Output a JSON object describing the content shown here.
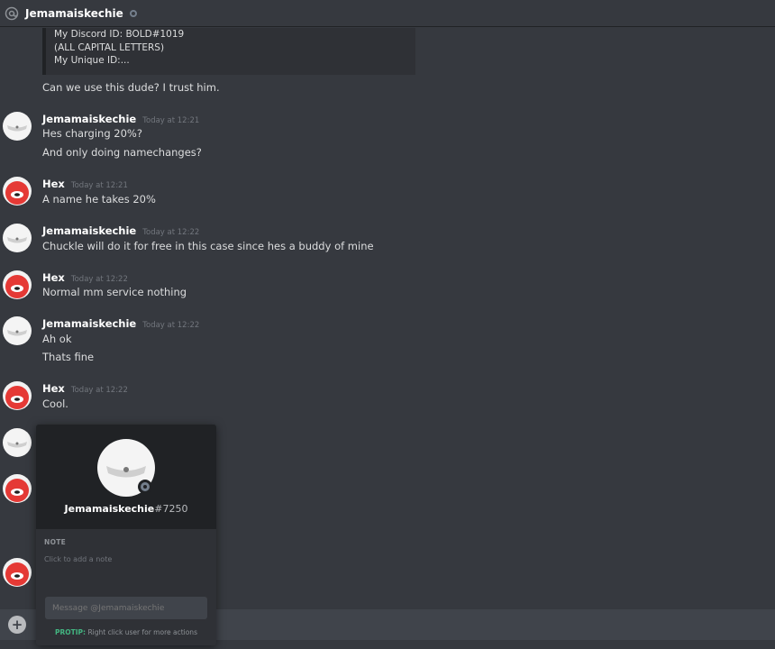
{
  "header": {
    "name": "Jemamaiskechie"
  },
  "embed": {
    "lines": [
      "My Discord ID: BOLD#1019",
      "(ALL CAPITAL LETTERS)",
      "My Unique ID:..."
    ]
  },
  "messages": [
    {
      "text": "Can we use this dude? I trust him."
    },
    {
      "author": "Jemamaiskechie",
      "time": "Today at 12:21",
      "lines": [
        "Hes charging 20%?",
        "And only doing namechanges?"
      ]
    },
    {
      "author": "Hex",
      "time": "Today at 12:21",
      "lines": [
        "A name he takes 20%"
      ]
    },
    {
      "author": "Jemamaiskechie",
      "time": "Today at 12:22",
      "lines": [
        "Chuckle will do it for free in this case since hes a buddy of mine"
      ]
    },
    {
      "author": "Hex",
      "time": "Today at 12:22",
      "lines": [
        "Normal mm service nothing"
      ]
    },
    {
      "author": "Jemamaiskechie",
      "time": "Today at 12:22",
      "lines": [
        "Ah ok",
        "Thats fine"
      ]
    },
    {
      "author": "Hex",
      "time": "Today at 12:22",
      "lines": [
        "Cool."
      ]
    }
  ],
  "popout": {
    "username": "Jemamaiskechie",
    "discriminator": "#7250",
    "note_label": "NOTE",
    "note_placeholder": "Click to add a note",
    "message_placeholder": "Message @Jemamaiskechie",
    "protip_label": "PROTIP:",
    "protip_text": "Right click user for more actions"
  },
  "composer": {
    "plus_label": "+"
  },
  "colors": {
    "background": "#36393f",
    "popout_header": "#202225",
    "protip": "#43b581",
    "hex_avatar": "#e53935"
  }
}
